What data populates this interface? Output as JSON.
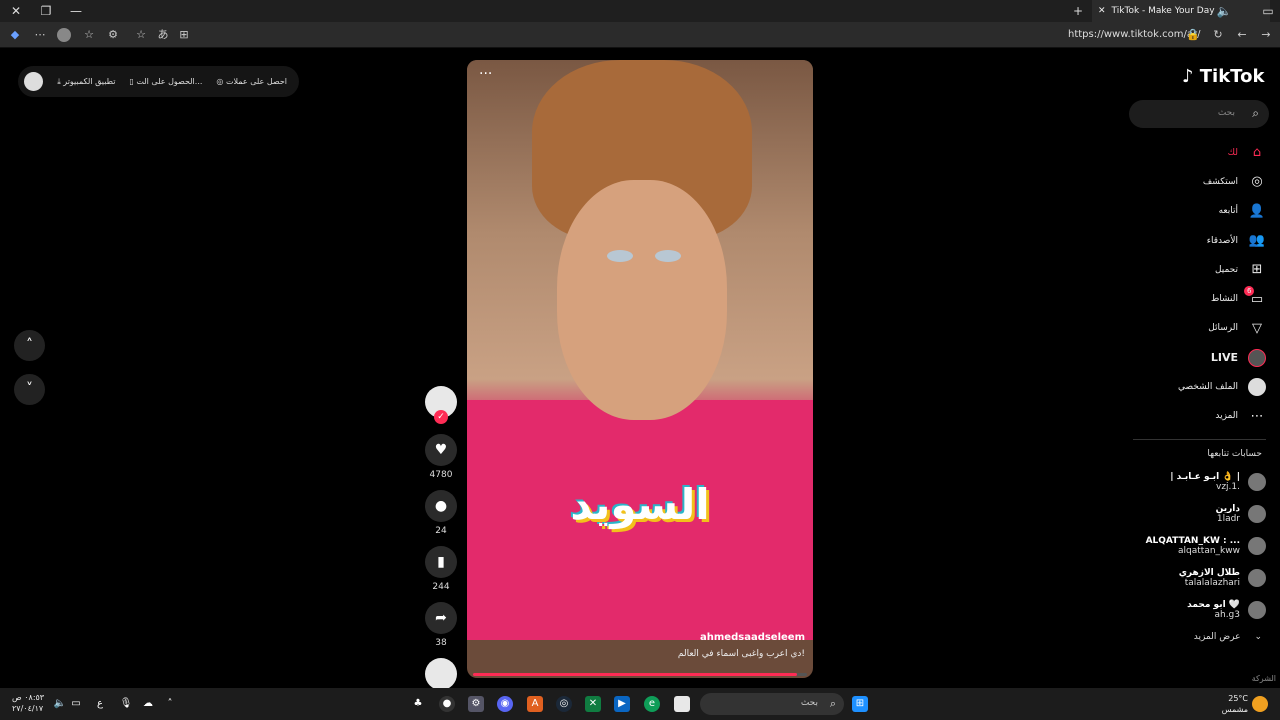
{
  "browser": {
    "tab_title": "TikTok - Make Your Day",
    "url": "https://www.tiktok.com/ar/"
  },
  "top_pill": {
    "get_coins": "احصل على عملات",
    "get_app": "الحصول على الت...",
    "desktop_app": "تطبيق الكمبيوتر"
  },
  "video": {
    "overlay_text": "السويد",
    "author": "ahmedsaadseleem",
    "description": "دي اعرب واغبى اسماء في العالم!",
    "progress": 0.97
  },
  "actions": {
    "likes": "4780",
    "comments": "24",
    "saves": "244",
    "shares": "38"
  },
  "sidebar": {
    "logo": "TikTok",
    "search_placeholder": "بحث",
    "items": [
      {
        "label": "لك",
        "icon": "home-icon"
      },
      {
        "label": "استكشف",
        "icon": "compass-icon"
      },
      {
        "label": "أتابعه",
        "icon": "user-follow-icon"
      },
      {
        "label": "الأصدقاء",
        "icon": "friends-icon"
      },
      {
        "label": "تحميل",
        "icon": "upload-icon"
      },
      {
        "label": "النشاط",
        "icon": "activity-icon",
        "badge": "6"
      },
      {
        "label": "الرسائل",
        "icon": "send-icon"
      },
      {
        "label": "LIVE",
        "icon": "live-icon"
      },
      {
        "label": "الملف الشخصي",
        "icon": "profile-icon"
      },
      {
        "label": "المزيد",
        "icon": "more-icon"
      }
    ],
    "following_title": "حسابات تتابعها",
    "following": [
      {
        "name": "| ابـو عـابـد 👌 |",
        "handle": "vzj.1."
      },
      {
        "name": "دارين",
        "handle": "1ladr"
      },
      {
        "name": "ALQATTAN_KW : ...",
        "handle": "alqattan_kww"
      },
      {
        "name": "طلال الازهري",
        "handle": "talalalazhari"
      },
      {
        "name": "ابو محمد 🤍",
        "handle": "ah.g3"
      }
    ],
    "see_more": "عرض المزيد",
    "company": "الشركة"
  },
  "taskbar": {
    "search": "بحث",
    "time": "٠٨:٥٣ ص",
    "date": "٢٧/٠٤/١٧",
    "lang": "ع",
    "temp": "25°C",
    "weather": "مشمس"
  }
}
